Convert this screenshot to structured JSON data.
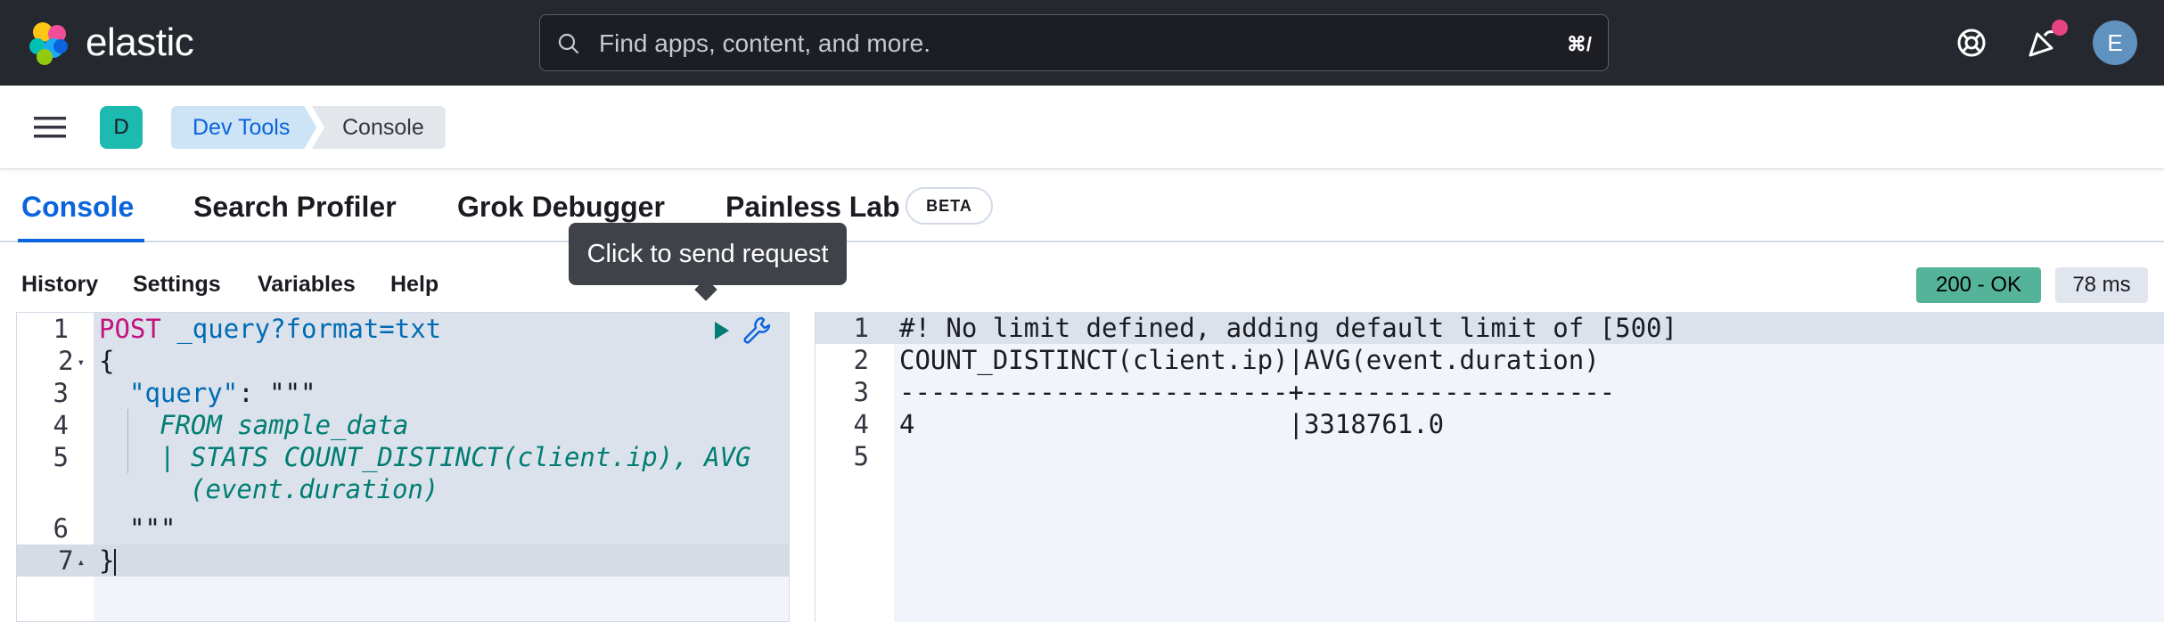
{
  "header": {
    "logo_text": "elastic",
    "search_placeholder": "Find apps, content, and more.",
    "search_shortcut": "⌘/",
    "avatar_initial": "E"
  },
  "subheader": {
    "space_initial": "D",
    "breadcrumbs": [
      "Dev Tools",
      "Console"
    ]
  },
  "tabs": [
    {
      "label": "Console",
      "active": true
    },
    {
      "label": "Search Profiler",
      "active": false
    },
    {
      "label": "Grok Debugger",
      "active": false
    },
    {
      "label": "Painless Lab",
      "active": false,
      "badge": "BETA"
    }
  ],
  "toolbar": {
    "items": [
      "History",
      "Settings",
      "Variables",
      "Help"
    ],
    "tooltip": "Click to send request",
    "status": "200 - OK",
    "timing": "78 ms"
  },
  "request_editor": {
    "line_numbers": [
      "1",
      "2",
      "3",
      "4",
      "5",
      "6",
      "7"
    ],
    "method": "POST",
    "path": "_query?format=txt",
    "lines": {
      "l2": "{",
      "l3_key": "\"query\"",
      "l3_rest": ": \"\"\"",
      "l4": "FROM sample_data",
      "l5a": "| STATS COUNT_DISTINCT(client.ip), AVG",
      "l5b": "(event.duration)",
      "l6": "\"\"\"",
      "l7": "}"
    }
  },
  "response_editor": {
    "line_numbers": [
      "1",
      "2",
      "3",
      "4",
      "5"
    ],
    "lines": [
      "#! No limit defined, adding default limit of [500]",
      "COUNT_DISTINCT(client.ip)|AVG(event.duration)",
      "-------------------------+--------------------",
      "4                        |3318761.0",
      ""
    ]
  },
  "colors": {
    "header_bg": "#25282f",
    "accent": "#0b64dd",
    "status_ok": "#54b399",
    "space_badge": "#1dbab0"
  }
}
